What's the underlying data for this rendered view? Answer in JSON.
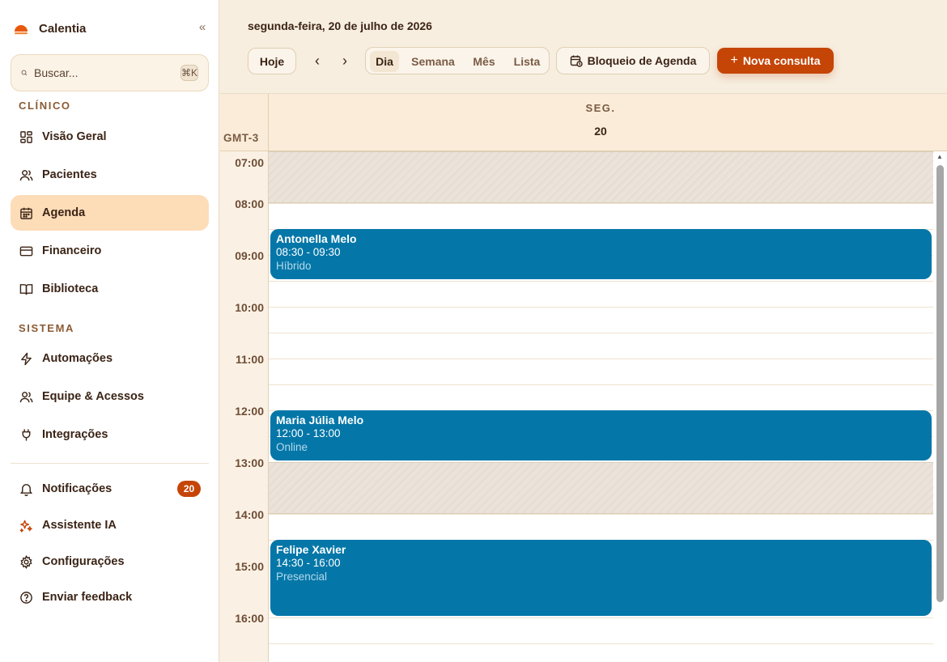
{
  "brand": {
    "name": "Calentia"
  },
  "sidebar": {
    "collapse_icon": "double-chevron-left-icon",
    "search": {
      "placeholder": "Buscar...",
      "shortcut": "⌘K"
    },
    "sections": {
      "clinical": "CLÍNICO",
      "system": "SISTEMA"
    },
    "clinical_items": [
      {
        "label": "Visão Geral",
        "icon": "grid-icon"
      },
      {
        "label": "Pacientes",
        "icon": "users-icon"
      },
      {
        "label": "Agenda",
        "icon": "calendar-icon",
        "active": true
      },
      {
        "label": "Financeiro",
        "icon": "credit-card-icon"
      },
      {
        "label": "Biblioteca",
        "icon": "book-icon"
      }
    ],
    "system_items": [
      {
        "label": "Automações",
        "icon": "zap-icon"
      },
      {
        "label": "Equipe & Acessos",
        "icon": "user-group-icon"
      },
      {
        "label": "Integrações",
        "icon": "plug-icon"
      }
    ],
    "bottom_items": [
      {
        "label": "Notificações",
        "icon": "bell-icon",
        "badge": "20"
      },
      {
        "label": "Assistente IA",
        "icon": "sparkles-icon"
      },
      {
        "label": "Configurações",
        "icon": "gear-icon"
      },
      {
        "label": "Enviar feedback",
        "icon": "help-circle-icon"
      }
    ]
  },
  "toolbar": {
    "date": "segunda-feira, 20 de julho de 2026",
    "today": "Hoje",
    "views": [
      "Dia",
      "Semana",
      "Mês",
      "Lista"
    ],
    "active_view": "Dia",
    "block": "Bloqueio de Agenda",
    "new": "Nova consulta",
    "new_prefix": "+"
  },
  "calendar": {
    "timezone": "GMT-3",
    "day_abbr": "SEG.",
    "day_num": "20",
    "hours": [
      "07:00",
      "08:00",
      "09:00",
      "10:00",
      "11:00",
      "12:00",
      "13:00",
      "14:00",
      "15:00",
      "16:00"
    ],
    "events": [
      {
        "name": "Antonella Melo",
        "time": "08:30 - 09:30",
        "type": "Híbrido"
      },
      {
        "name": "Maria Júlia Melo",
        "time": "12:00 - 13:00",
        "type": "Online"
      },
      {
        "name": "Felipe Xavier",
        "time": "14:30 - 16:00",
        "type": "Presencial"
      }
    ],
    "blocked_periods": [
      "07:00 - 08:00",
      "13:00 - 14:00"
    ]
  },
  "colors": {
    "accent": "#c54507",
    "active_nav": "#fddcb8",
    "event": "#0477a8",
    "background": "#f7eedf"
  }
}
